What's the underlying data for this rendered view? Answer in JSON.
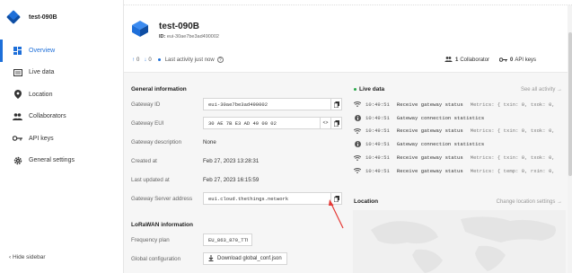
{
  "sidebar": {
    "title": "test-090B",
    "items": [
      {
        "label": "Overview",
        "icon": "grid-icon",
        "active": true
      },
      {
        "label": "Live data",
        "icon": "list-icon"
      },
      {
        "label": "Location",
        "icon": "pin-icon"
      },
      {
        "label": "Collaborators",
        "icon": "people-icon"
      },
      {
        "label": "API keys",
        "icon": "key-icon"
      },
      {
        "label": "General settings",
        "icon": "gear-icon"
      }
    ],
    "hide_label": "Hide sidebar"
  },
  "header": {
    "title": "test-090B",
    "id_label": "ID:",
    "id_value": "eui-30ae7be3ad490002",
    "uplink_count": "0",
    "downlink_count": "0",
    "last_activity": "Last activity just now",
    "collaborators_count": "1",
    "collaborators_label": "Collaborator",
    "api_keys_count": "0",
    "api_keys_label": "API keys"
  },
  "general": {
    "title": "General information",
    "gateway_id_label": "Gateway ID",
    "gateway_id": "eui-30ae7be3ad490002",
    "gateway_eui_label": "Gateway EUI",
    "gateway_eui": "30 AE 7B E3 AD 49 00 02",
    "description_label": "Gateway description",
    "description": "None",
    "created_label": "Created at",
    "created": "Feb 27, 2023 13:28:31",
    "updated_label": "Last updated at",
    "updated": "Feb 27, 2023 16:15:59",
    "server_label": "Gateway Server address",
    "server": "eu1.cloud.thethings.network"
  },
  "lorawan": {
    "title": "LoRaWAN information",
    "freq_label": "Frequency plan",
    "freq": "EU_863_870_TTN",
    "global_label": "Global configuration",
    "download_label": "Download global_conf.json"
  },
  "live": {
    "title": "Live data",
    "see_all": "See all activity →",
    "rows": [
      {
        "time": "10:49:51",
        "message": "Receive gateway status",
        "meta": "Metrics: { txin: 0, txok: 0,",
        "icon": "wifi-icon"
      },
      {
        "time": "10:49:51",
        "message": "Gateway connection statistics",
        "meta": "",
        "icon": "info-icon"
      },
      {
        "time": "10:49:51",
        "message": "Receive gateway status",
        "meta": "Metrics: { txin: 0, txok: 0,",
        "icon": "wifi-icon"
      },
      {
        "time": "10:49:51",
        "message": "Gateway connection statistics",
        "meta": "",
        "icon": "info-icon"
      },
      {
        "time": "10:49:51",
        "message": "Receive gateway status",
        "meta": "Metrics: { txin: 0, txok: 0,",
        "icon": "wifi-icon"
      },
      {
        "time": "10:49:51",
        "message": "Receive gateway status",
        "meta": "Metrics: { temp: 0, rxin: 0,",
        "icon": "wifi-icon"
      }
    ]
  },
  "location": {
    "title": "Location",
    "change": "Change location settings →"
  },
  "colors": {
    "accent": "#1e6fd9",
    "live_dot": "#2aa84a",
    "annotation_arrow": "#e53935"
  }
}
